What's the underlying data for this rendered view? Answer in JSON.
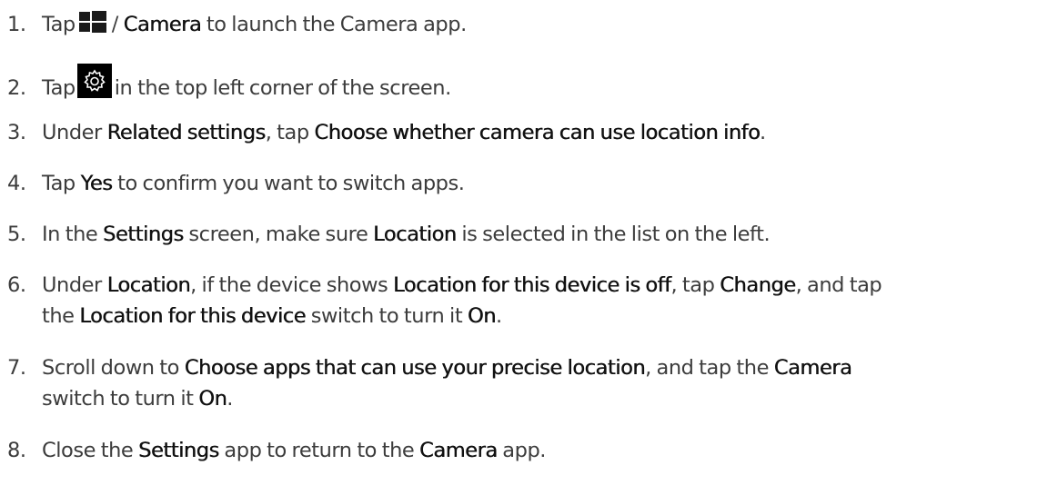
{
  "steps": [
    {
      "num": "1.",
      "a": "Tap",
      "b": "/",
      "c": "Camera",
      "d": "to launch the Camera app."
    },
    {
      "num": "2.",
      "a": "Tap",
      "b": "in the top left corner of the screen."
    },
    {
      "num": "3.",
      "a": "Under",
      "b": "Related settings",
      "c": ", tap",
      "d": "Choose whether camera can use location info",
      "e": "."
    },
    {
      "num": "4.",
      "a": "Tap",
      "b": "Yes",
      "c": "to confirm you want to switch apps."
    },
    {
      "num": "5.",
      "a": "In the",
      "b": "Settings",
      "c": "screen, make sure",
      "d": "Location",
      "e": "is selected in the list on the left."
    },
    {
      "num": "6.",
      "a": "Under",
      "b": "Location",
      "c": ", if the device shows",
      "d": "Location for this device is off",
      "e": ", tap",
      "f": "Change",
      "g": ", and tap",
      "h": "the",
      "i": "Location for this device",
      "j": "switch to turn it",
      "k": "On",
      "l": "."
    },
    {
      "num": "7.",
      "a": "Scroll down to",
      "b": "Choose apps that can use your precise location",
      "c": ", and tap the",
      "d": "Camera",
      "e": "switch to turn it",
      "f": "On",
      "g": "."
    },
    {
      "num": "8.",
      "a": "Close the",
      "b": "Settings",
      "c": "app to return to the",
      "d": "Camera",
      "e": "app."
    }
  ],
  "icons": {
    "step1": "windows-logo-icon",
    "step2": "gear-icon"
  }
}
